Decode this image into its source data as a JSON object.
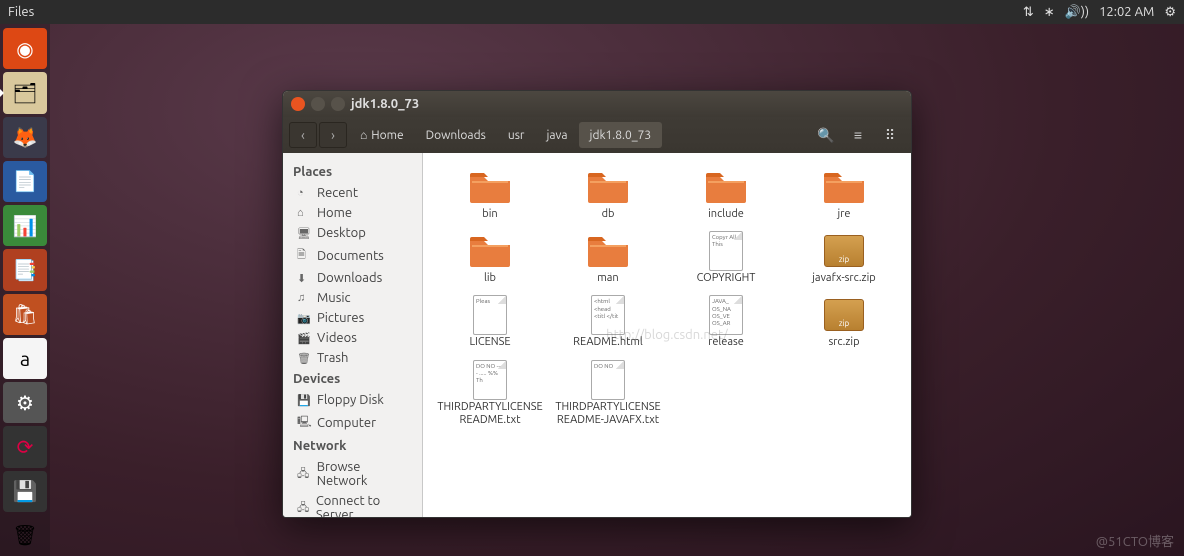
{
  "topbar": {
    "app": "Files",
    "time": "12:02 AM"
  },
  "launcher": [
    {
      "name": "ubuntu-dash",
      "glyph": "◉",
      "cls": "ubuntu"
    },
    {
      "name": "files-app",
      "glyph": "🗂",
      "cls": "files",
      "active": true
    },
    {
      "name": "firefox",
      "glyph": "🦊",
      "cls": "firefox"
    },
    {
      "name": "writer",
      "glyph": "📄",
      "cls": "writer"
    },
    {
      "name": "calc",
      "glyph": "📊",
      "cls": "calc"
    },
    {
      "name": "impress",
      "glyph": "📑",
      "cls": "impress"
    },
    {
      "name": "software-center",
      "glyph": "🛍",
      "cls": "soft"
    },
    {
      "name": "amazon",
      "glyph": "a",
      "cls": "amazon"
    },
    {
      "name": "settings",
      "glyph": "⚙",
      "cls": "settings"
    },
    {
      "name": "software-updater",
      "glyph": "⟳",
      "cls": "update"
    },
    {
      "name": "disk",
      "glyph": "💾",
      "cls": "disk"
    },
    {
      "name": "trash",
      "glyph": "🗑",
      "cls": "trash"
    }
  ],
  "window": {
    "title": "jdk1.8.0_73",
    "breadcrumbs": [
      {
        "label": "Home",
        "icon": "⌂"
      },
      {
        "label": "Downloads"
      },
      {
        "label": "usr"
      },
      {
        "label": "java"
      },
      {
        "label": "jdk1.8.0_73",
        "current": true
      }
    ]
  },
  "sidebar": {
    "places": {
      "head": "Places",
      "items": [
        {
          "icon": "◔",
          "label": "Recent"
        },
        {
          "icon": "⌂",
          "label": "Home"
        },
        {
          "icon": "🖥",
          "label": "Desktop"
        },
        {
          "icon": "🗎",
          "label": "Documents"
        },
        {
          "icon": "⬇",
          "label": "Downloads"
        },
        {
          "icon": "♫",
          "label": "Music"
        },
        {
          "icon": "📷",
          "label": "Pictures"
        },
        {
          "icon": "🎬",
          "label": "Videos"
        },
        {
          "icon": "🗑",
          "label": "Trash"
        }
      ]
    },
    "devices": {
      "head": "Devices",
      "items": [
        {
          "icon": "💾",
          "label": "Floppy Disk"
        },
        {
          "icon": "🖳",
          "label": "Computer"
        }
      ]
    },
    "network": {
      "head": "Network",
      "items": [
        {
          "icon": "🖧",
          "label": "Browse Network"
        },
        {
          "icon": "🖧",
          "label": "Connect to Server"
        }
      ]
    }
  },
  "files": [
    {
      "type": "folder",
      "name": "bin"
    },
    {
      "type": "folder",
      "name": "db"
    },
    {
      "type": "folder",
      "name": "include"
    },
    {
      "type": "folder",
      "name": "jre"
    },
    {
      "type": "folder",
      "name": "lib"
    },
    {
      "type": "folder",
      "name": "man"
    },
    {
      "type": "text",
      "name": "COPYRIGHT",
      "preview": "Copyr\nAll r\n\nThis"
    },
    {
      "type": "zip",
      "name": "javafx-src.zip"
    },
    {
      "type": "text",
      "name": "LICENSE",
      "preview": "Pleas"
    },
    {
      "type": "text",
      "name": "README.html",
      "preview": "<html\n<head\n<titl\n</tit"
    },
    {
      "type": "text",
      "name": "release",
      "preview": "JAVA_\nOS_NA\nOS_VE\nOS_AR"
    },
    {
      "type": "zip",
      "name": "src.zip"
    },
    {
      "type": "text",
      "name": "THIRDPARTYLICENSEREADME.txt",
      "preview": "DO NO\n-----\n.....\n%% Th"
    },
    {
      "type": "text",
      "name": "THIRDPARTYLICENSEREADME-JAVAFX.txt",
      "preview": "DO NO"
    }
  ],
  "watermark": "@51CTO博客",
  "wm2": "http://blog.csdn.net/"
}
